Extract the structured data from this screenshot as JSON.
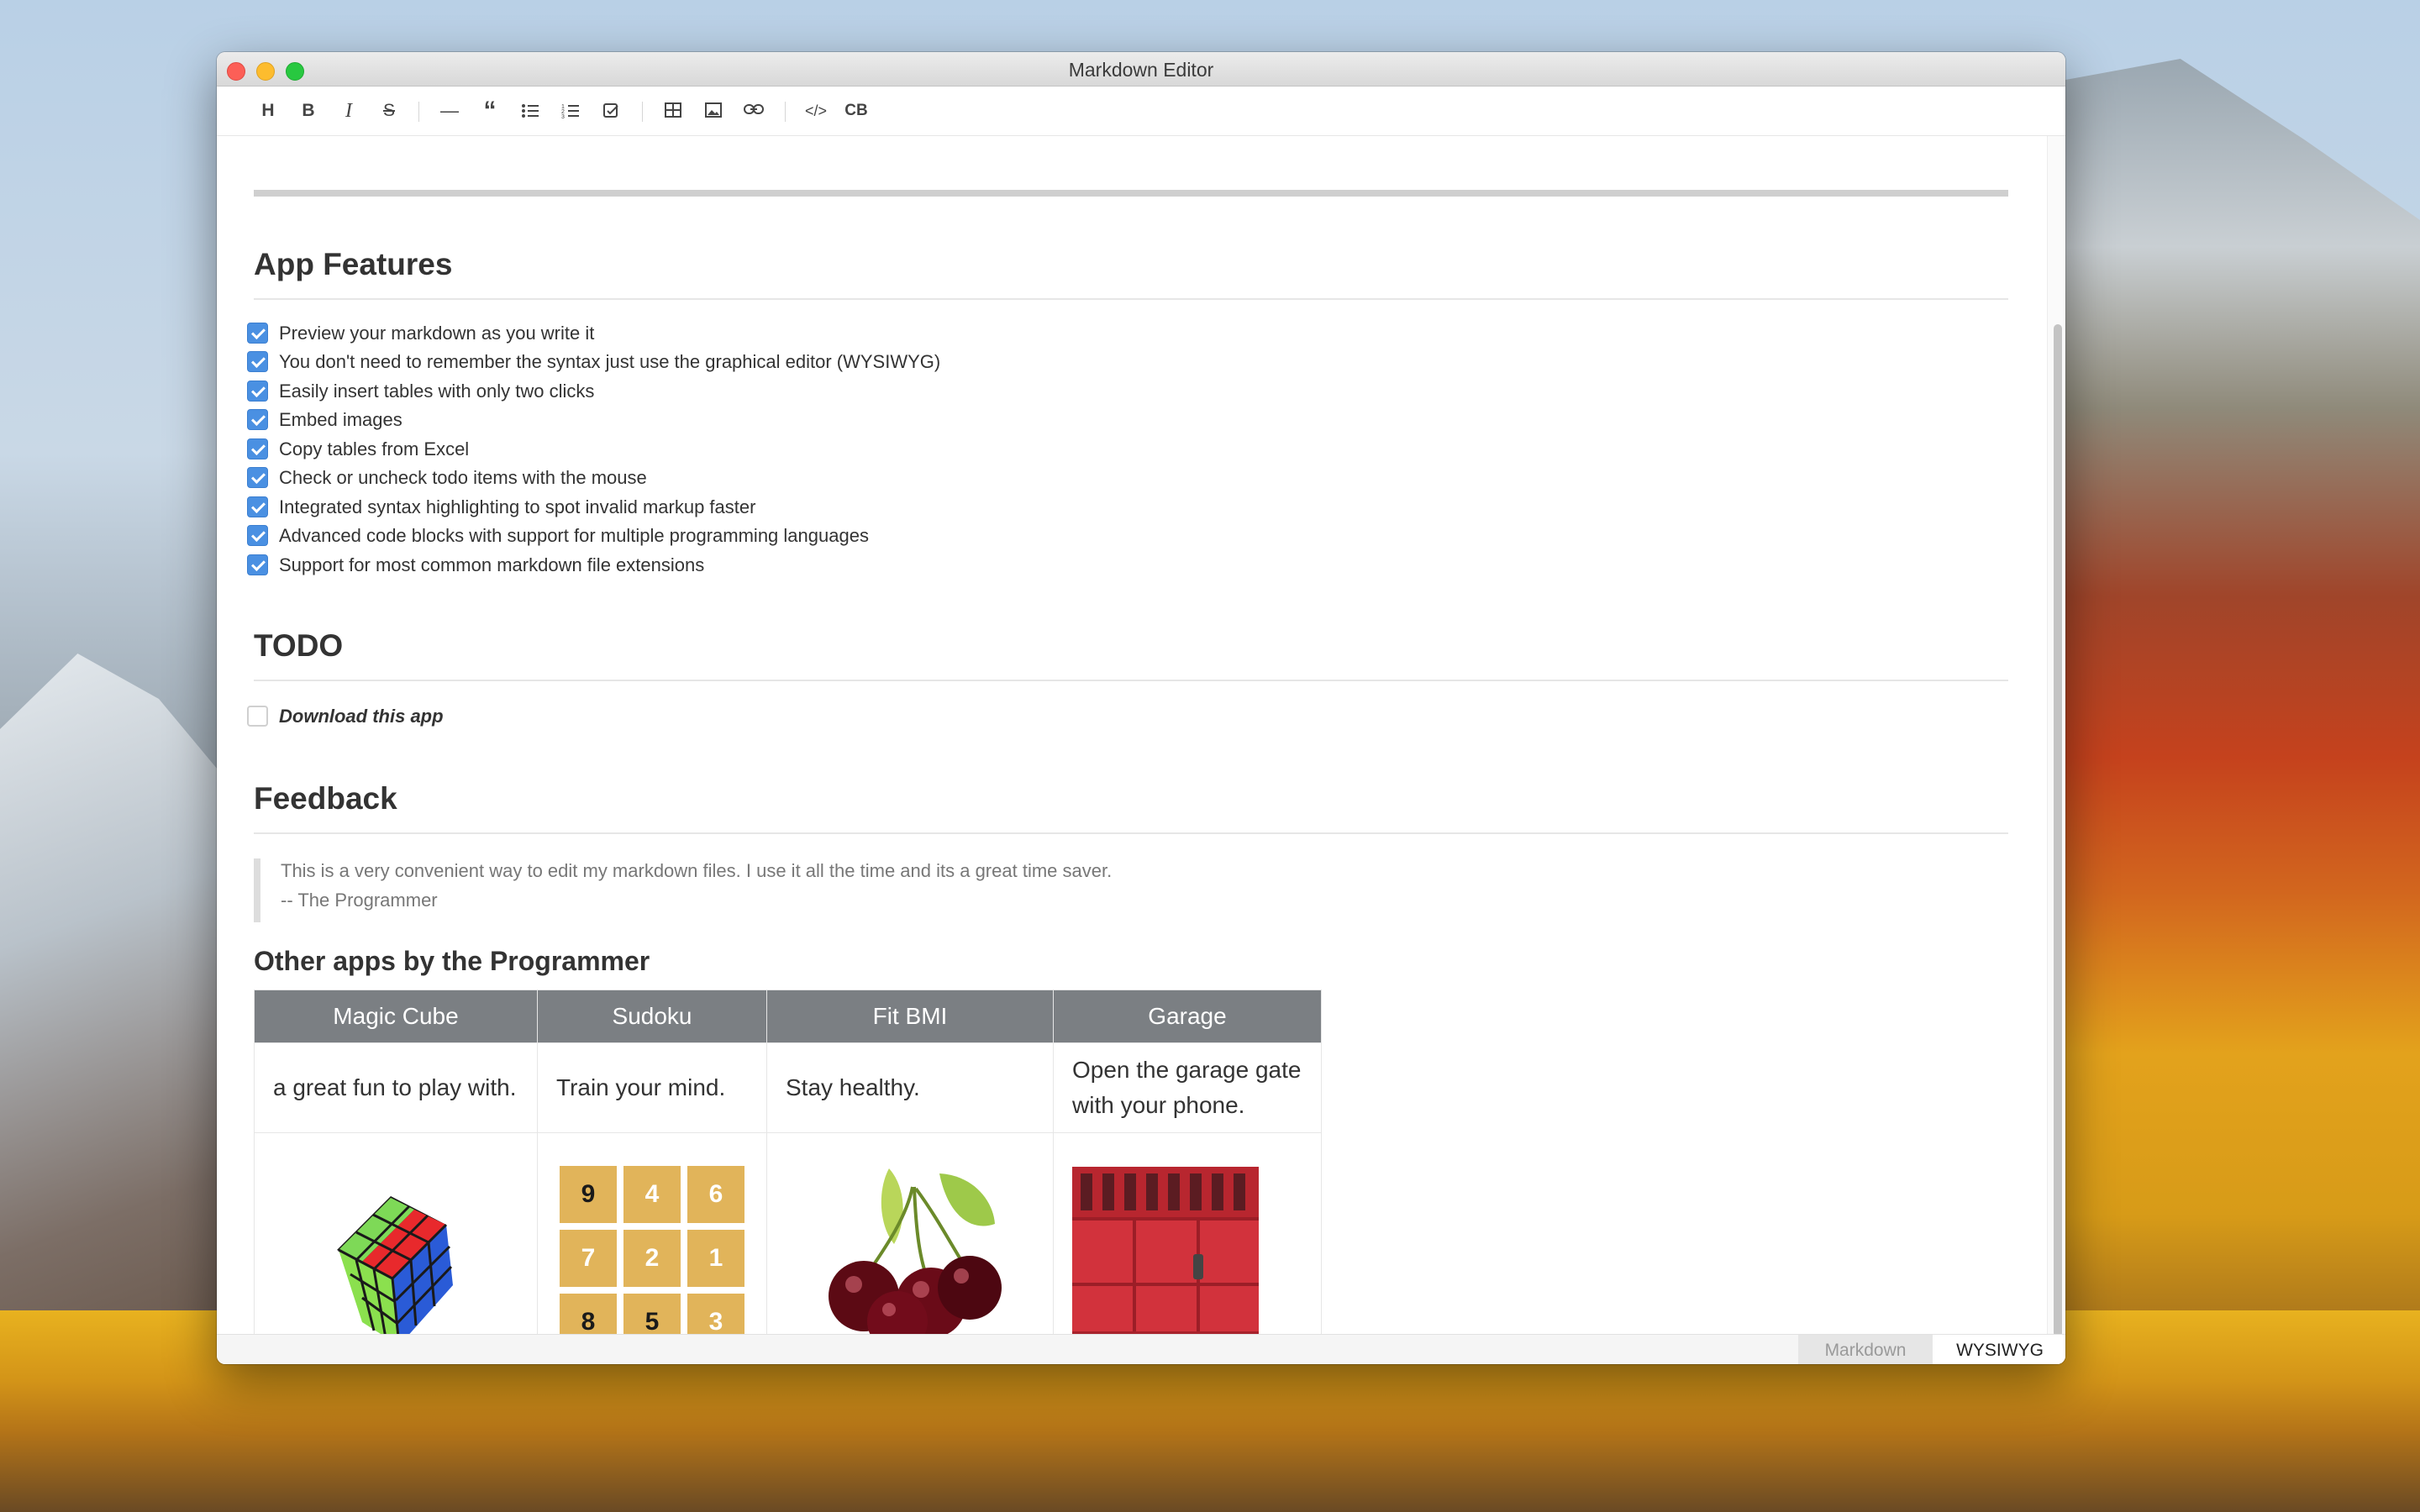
{
  "window": {
    "title": "Markdown Editor"
  },
  "toolbar": {
    "items": [
      {
        "name": "heading-button",
        "glyph": "H"
      },
      {
        "name": "bold-button",
        "glyph": "B"
      },
      {
        "name": "italic-button",
        "glyph": "I"
      },
      {
        "name": "strikethrough-button",
        "glyph": "S"
      },
      {
        "name": "horizontal-rule-button",
        "glyph": "—"
      },
      {
        "name": "quote-button",
        "glyph": "“"
      },
      {
        "name": "bullet-list-button",
        "glyph": "list"
      },
      {
        "name": "numbered-list-button",
        "glyph": "numbered-list"
      },
      {
        "name": "task-list-button",
        "glyph": "checkbox"
      },
      {
        "name": "table-button",
        "glyph": "table"
      },
      {
        "name": "image-button",
        "glyph": "image"
      },
      {
        "name": "link-button",
        "glyph": "link"
      },
      {
        "name": "code-button",
        "glyph": "</>"
      },
      {
        "name": "code-block-button",
        "glyph": "CB"
      }
    ]
  },
  "features": {
    "heading": "App Features",
    "items": [
      {
        "label": "Preview your markdown as you write it",
        "checked": true
      },
      {
        "label": "You don't need to remember the syntax just use the graphical editor (WYSIWYG)",
        "checked": true
      },
      {
        "label": "Easily insert tables with only two clicks",
        "checked": true
      },
      {
        "label": "Embed images",
        "checked": true
      },
      {
        "label": "Copy tables from Excel",
        "checked": true
      },
      {
        "label": "Check or uncheck todo items with the mouse",
        "checked": true
      },
      {
        "label": "Integrated syntax highlighting to spot invalid markup faster",
        "checked": true
      },
      {
        "label": "Advanced code blocks with support for multiple programming languages",
        "checked": true
      },
      {
        "label": "Support for most common markdown file extensions",
        "checked": true
      }
    ]
  },
  "todo": {
    "heading": "TODO",
    "items": [
      {
        "label": "Download this app",
        "checked": false
      }
    ]
  },
  "feedback": {
    "heading": "Feedback",
    "quote_line1": "This is a very convenient way to edit my markdown files. I use it all the time and its a great time saver.",
    "quote_line2": "-- The Programmer"
  },
  "other_apps": {
    "heading": "Other apps by the Programmer",
    "columns": [
      "Magic Cube",
      "Sudoku",
      "Fit BMI",
      "Garage"
    ],
    "descriptions": [
      "a great fun to play with.",
      "Train your mind.",
      "Stay healthy.",
      "Open the garage gate with your phone."
    ],
    "images": [
      "rubiks-cube-image",
      "sudoku-grid-image",
      "cherries-image",
      "garage-door-image"
    ],
    "sudoku_digits": [
      "9",
      "4",
      "6",
      "7",
      "2",
      "1",
      "8",
      "5",
      "3"
    ]
  },
  "status_bar": {
    "markdown_label": "Markdown",
    "wysiwyg_label": "WYSIWYG"
  },
  "colors": {
    "checkbox": "#4a90e2",
    "table_header": "#7b7f83",
    "sudoku_tile": "#e1b45a"
  }
}
